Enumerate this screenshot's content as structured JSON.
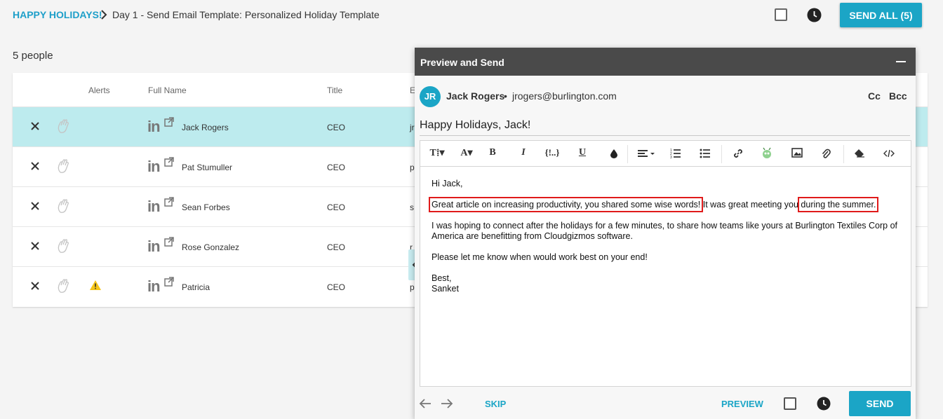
{
  "breadcrumb": {
    "root": "HAPPY HOLIDAYS!",
    "page": "Day 1 - Send Email Template: Personalized Holiday Template"
  },
  "header_actions": {
    "send_all_label": "SEND ALL (5)"
  },
  "people_count": "5 people",
  "table": {
    "columns": [
      "Alerts",
      "Full Name",
      "Title",
      "E"
    ],
    "rows": [
      {
        "name": "Jack Rogers",
        "title": "CEO",
        "email": "jr",
        "alert": false,
        "selected": true
      },
      {
        "name": "Pat Stumuller",
        "title": "CEO",
        "email": "p",
        "alert": false,
        "selected": false
      },
      {
        "name": "Sean Forbes",
        "title": "CEO",
        "email": "s",
        "alert": false,
        "selected": false
      },
      {
        "name": "Rose Gonzalez",
        "title": "CEO",
        "email": "r",
        "alert": false,
        "selected": false
      },
      {
        "name": "Patricia",
        "title": "CEO",
        "email": "p",
        "alert": true,
        "selected": false
      }
    ],
    "linkedin_label": "in"
  },
  "panel": {
    "title": "Preview and Send",
    "recipient": {
      "initials": "JR",
      "name": "Jack Rogers",
      "separator": "•",
      "email": "jrogers@burlington.com"
    },
    "cc_label": "Cc",
    "bcc_label": "Bcc",
    "subject": "Happy Holidays, Jack!",
    "toolbar": {
      "text_size": "T⁞▾",
      "font": "A▾",
      "bold": "B",
      "italic": "I",
      "merge": "{!..}",
      "underline": "U"
    },
    "body": {
      "greeting": "Hi Jack,",
      "line1_highlight_a": "Great article on increasing productivity, you shared some wise words!",
      "line1_middle": " It was great meeting you ",
      "line1_highlight_b": "during the summer.",
      "para2": "I was hoping to connect after the holidays for a few minutes, to share how teams like yours at Burlington Textiles Corp of America are benefitting from Cloudgizmos software.",
      "para3": "Please let me know when would work best on your end!",
      "signoff": "Best,",
      "signature": "Sanket"
    },
    "footer": {
      "skip_label": "SKIP",
      "preview_label": "PREVIEW",
      "send_label": "SEND"
    }
  },
  "colors": {
    "accent": "#1ba5c6",
    "selected_row": "#bdebee",
    "panel_header": "#4a4a4a",
    "highlight_box": "#e01b1b",
    "warning": "#f5c518"
  }
}
